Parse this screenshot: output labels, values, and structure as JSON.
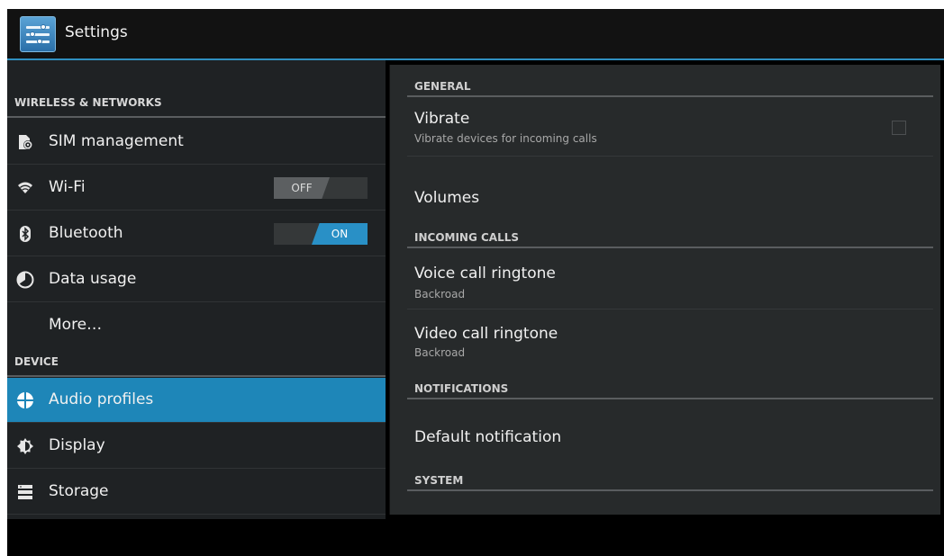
{
  "action_bar": {
    "title": "Settings",
    "icon": "settings-sliders-icon"
  },
  "left": {
    "sections": [
      {
        "header": "WIRELESS & NETWORKS"
      },
      {
        "header": "DEVICE"
      }
    ],
    "items": [
      {
        "label": "SIM management",
        "icon": "sim-icon"
      },
      {
        "label": "Wi-Fi",
        "icon": "wifi-icon",
        "toggle": "OFF"
      },
      {
        "label": "Bluetooth",
        "icon": "bluetooth-icon",
        "toggle": "ON"
      },
      {
        "label": "Data usage",
        "icon": "data-usage-icon"
      },
      {
        "label": "More…"
      },
      {
        "label": "Audio profiles",
        "icon": "audio-profiles-icon",
        "selected": true
      },
      {
        "label": "Display",
        "icon": "display-icon"
      },
      {
        "label": "Storage",
        "icon": "storage-icon"
      }
    ]
  },
  "right": {
    "headers": [
      "GENERAL",
      "INCOMING CALLS",
      "NOTIFICATIONS",
      "SYSTEM"
    ],
    "items": [
      {
        "title": "Vibrate",
        "summary": "Vibrate devices for incoming calls",
        "checkbox": false
      },
      {
        "title": "Volumes"
      },
      {
        "title": "Voice call ringtone",
        "summary": "Backroad"
      },
      {
        "title": "Video call ringtone",
        "summary": "Backroad"
      },
      {
        "title": "Default notification"
      }
    ]
  },
  "colors": {
    "accent": "#1e86b8",
    "toggle_on": "#2990c6",
    "background": "#1f2224"
  }
}
